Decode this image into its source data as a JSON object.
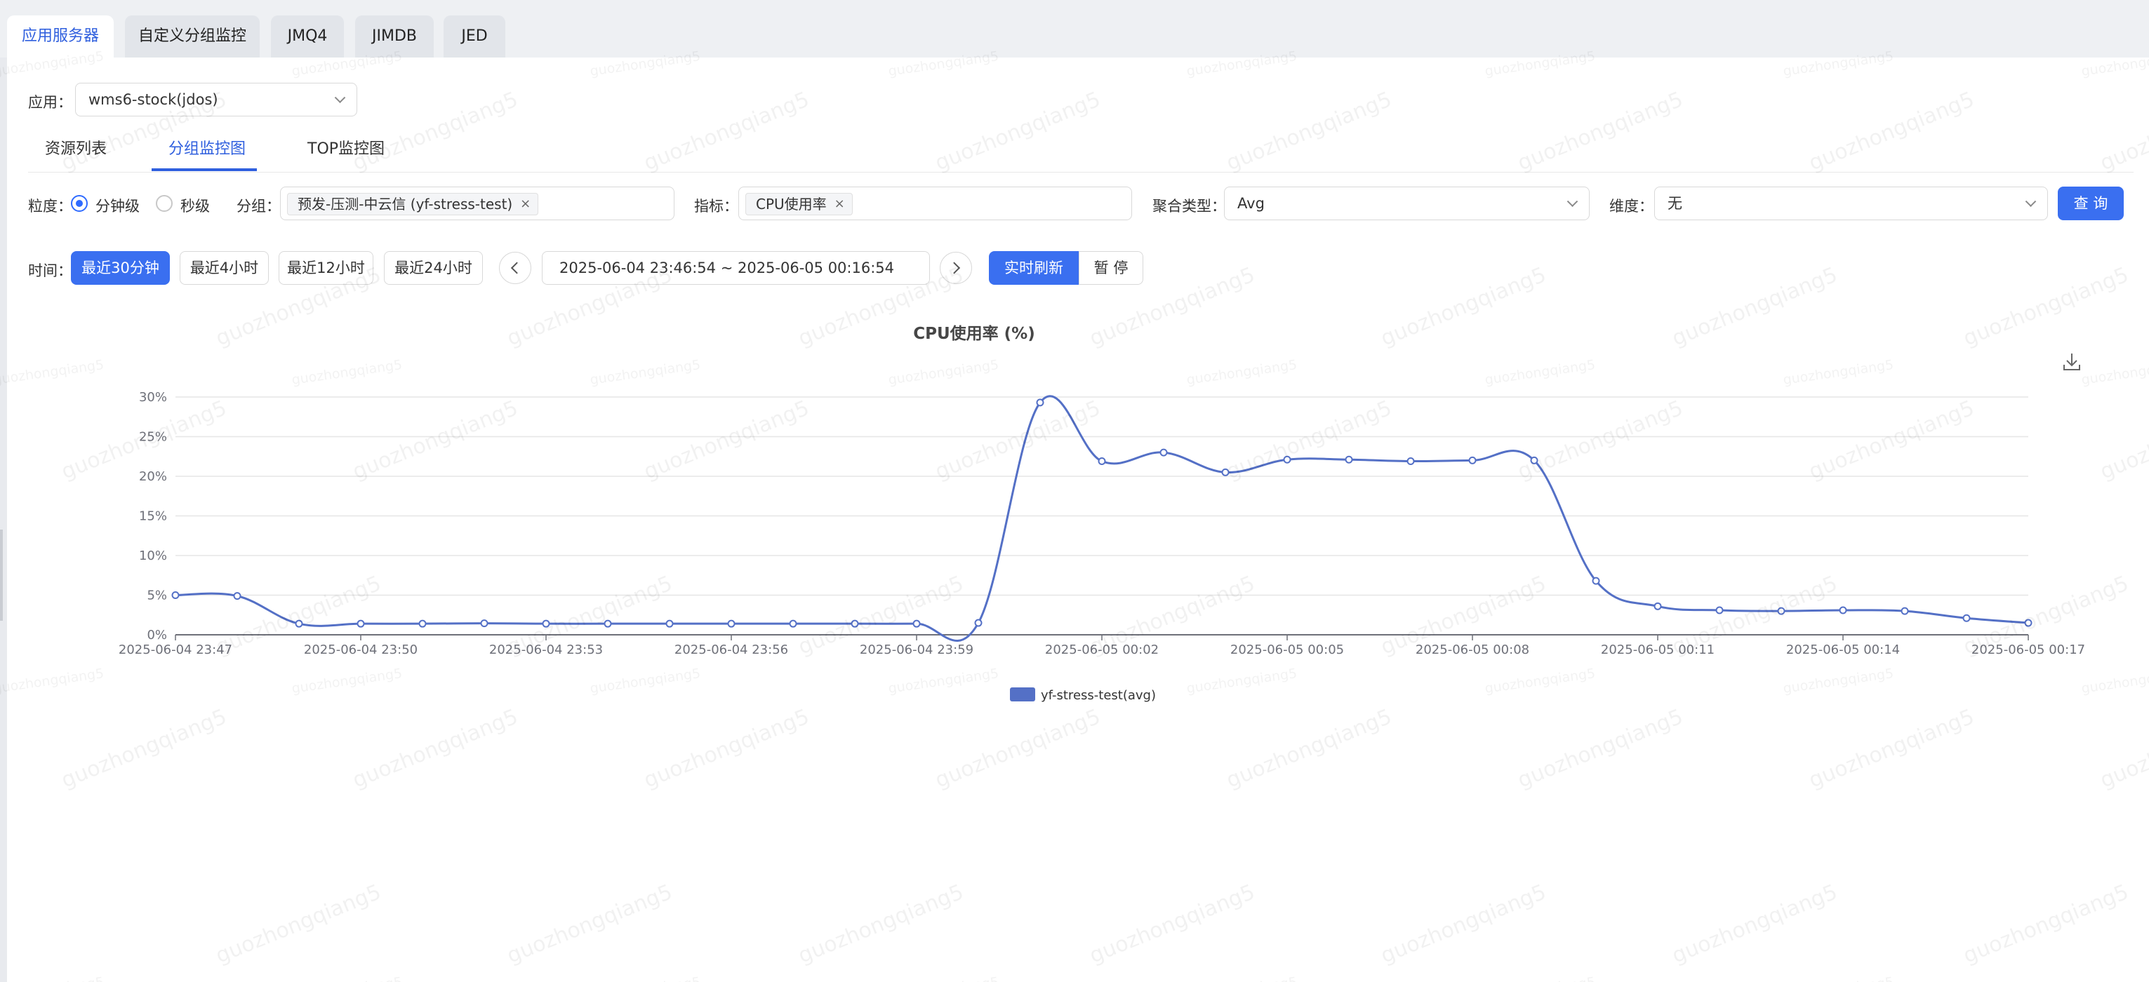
{
  "top_tabs": [
    {
      "label": "应用服务器",
      "active": true
    },
    {
      "label": "自定义分组监控",
      "active": false
    },
    {
      "label": "JMQ4",
      "active": false
    },
    {
      "label": "JIMDB",
      "active": false
    },
    {
      "label": "JED",
      "active": false
    }
  ],
  "app_select": {
    "label": "应用：",
    "value": "wms6-stock(jdos)"
  },
  "sub_tabs": [
    {
      "label": "资源列表",
      "active": false
    },
    {
      "label": "分组监控图",
      "active": true
    },
    {
      "label": "TOP监控图",
      "active": false
    }
  ],
  "filters": {
    "granularity_label": "粒度：",
    "granularity_options": [
      {
        "label": "分钟级",
        "selected": true
      },
      {
        "label": "秒级",
        "selected": false
      }
    ],
    "group_label": "分组：",
    "group_tag": "预发-压测-中云信 (yf-stress-test)",
    "metric_label": "指标：",
    "metric_tag": "CPU使用率",
    "agg_label": "聚合类型：",
    "agg_value": "Avg",
    "dimension_label": "维度：",
    "dimension_value": "无",
    "query_button": "查 询"
  },
  "time": {
    "label": "时间：",
    "presets": [
      {
        "label": "最近30分钟",
        "active": true
      },
      {
        "label": "最近4小时",
        "active": false
      },
      {
        "label": "最近12小时",
        "active": false
      },
      {
        "label": "最近24小时",
        "active": false
      }
    ],
    "range": "2025-06-04 23:46:54  ~  2025-06-05 00:16:54",
    "refresh_label": "实时刷新",
    "pause_label": "暂 停"
  },
  "icons": {
    "download": "download-icon",
    "prev": "chevron-left-icon",
    "next": "chevron-right-icon",
    "dropdown": "chevron-down-icon",
    "tag_close": "close-icon"
  },
  "colors": {
    "accent": "#3a6ff0",
    "series": "#5470c6",
    "grid": "#e6e6e6"
  },
  "watermark_text": "guozhongqiang5",
  "chart_data": {
    "type": "line",
    "title": "CPU使用率 (%)",
    "xlabel": "",
    "ylabel": "",
    "ylim": [
      0,
      30
    ],
    "y_ticks": [
      "0%",
      "5%",
      "10%",
      "15%",
      "20%",
      "25%",
      "30%"
    ],
    "x_ticks": [
      "2025-06-04 23:47",
      "2025-06-04 23:50",
      "2025-06-04 23:53",
      "2025-06-04 23:56",
      "2025-06-04 23:59",
      "2025-06-05 00:02",
      "2025-06-05 00:05",
      "2025-06-05 00:08",
      "2025-06-05 00:11",
      "2025-06-05 00:14",
      "2025-06-05 00:17"
    ],
    "x": [
      "2025-06-04 23:47",
      "2025-06-04 23:48",
      "2025-06-04 23:49",
      "2025-06-04 23:50",
      "2025-06-04 23:51",
      "2025-06-04 23:52",
      "2025-06-04 23:53",
      "2025-06-04 23:54",
      "2025-06-04 23:55",
      "2025-06-04 23:56",
      "2025-06-04 23:57",
      "2025-06-04 23:58",
      "2025-06-04 23:59",
      "2025-06-05 00:00",
      "2025-06-05 00:01",
      "2025-06-05 00:02",
      "2025-06-05 00:03",
      "2025-06-05 00:04",
      "2025-06-05 00:05",
      "2025-06-05 00:06",
      "2025-06-05 00:07",
      "2025-06-05 00:08",
      "2025-06-05 00:09",
      "2025-06-05 00:10",
      "2025-06-05 00:11",
      "2025-06-05 00:12",
      "2025-06-05 00:13",
      "2025-06-05 00:14",
      "2025-06-05 00:15",
      "2025-06-05 00:16",
      "2025-06-05 00:17"
    ],
    "series": [
      {
        "name": "yf-stress-test(avg)",
        "values": [
          5.0,
          4.9,
          1.4,
          1.4,
          1.4,
          1.45,
          1.4,
          1.4,
          1.4,
          1.4,
          1.4,
          1.4,
          1.4,
          1.5,
          29.3,
          21.9,
          23.0,
          20.5,
          22.1,
          22.1,
          21.9,
          22.0,
          22.0,
          6.8,
          3.6,
          3.1,
          3.0,
          3.1,
          3.0,
          2.1,
          1.5
        ]
      }
    ],
    "grid": true,
    "legend": "bottom-center"
  }
}
